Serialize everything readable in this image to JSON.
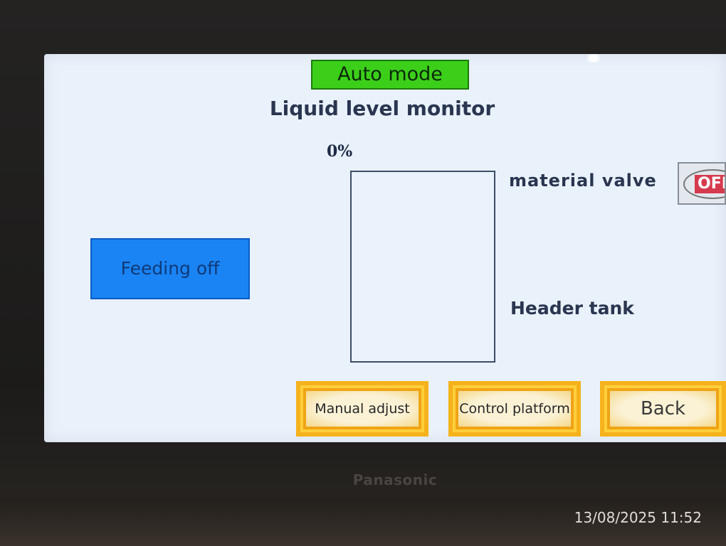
{
  "header": {
    "mode": "Auto mode",
    "title": "Liquid level monitor"
  },
  "tank": {
    "level_text": "0%",
    "level_fraction": 0,
    "name": "Header tank"
  },
  "valve": {
    "label": "material valve",
    "state": "OFF"
  },
  "feed_button": {
    "label": "Feeding off"
  },
  "nav": {
    "manual_label": "Manual adjust",
    "control_label": "Control platform",
    "back_label": "Back"
  },
  "device": {
    "brand": "Panasonic"
  },
  "photo": {
    "timestamp": "13/08/2025 11:52"
  },
  "colors": {
    "mode_badge": "#3ccf1a",
    "feed_button": "#1a84f4",
    "nav_button": "#f0a416",
    "valve_off": "#d63a4e"
  }
}
